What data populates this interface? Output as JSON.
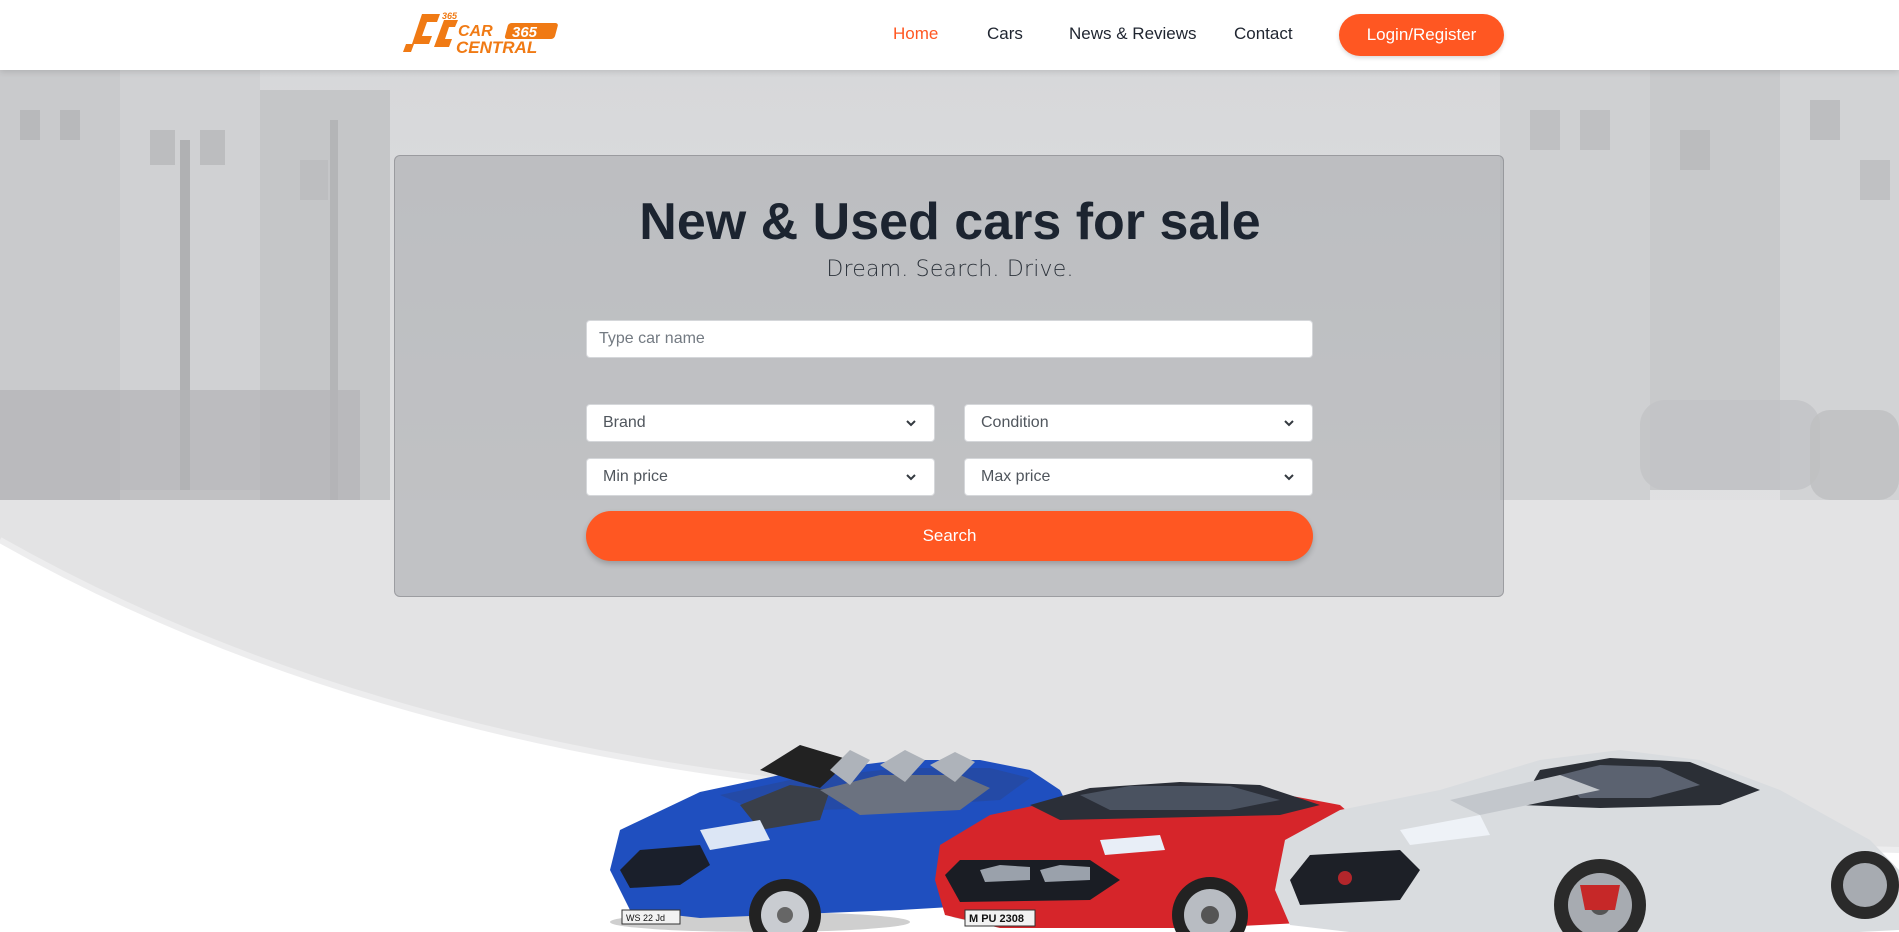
{
  "brand": {
    "logo_icon": "car-central-365-logo",
    "colors": {
      "accent": "#ff5722",
      "logo_orange": "#f07a14",
      "dark_text": "#1c2430"
    }
  },
  "nav": {
    "items": [
      {
        "label": "Home",
        "active": true
      },
      {
        "label": "Cars",
        "active": false
      },
      {
        "label": "News & Reviews",
        "active": false
      },
      {
        "label": "Contact",
        "active": false
      }
    ],
    "login_label": "Login/Register"
  },
  "hero": {
    "title": "New & Used cars for sale",
    "subtitle": "Dream. Search. Drive."
  },
  "search": {
    "car_name_placeholder": "Type car name",
    "brand_label": "Brand",
    "condition_label": "Condition",
    "min_price_label": "Min price",
    "max_price_label": "Max price",
    "search_label": "Search"
  },
  "cars": {
    "items": [
      {
        "name": "blue-convertible",
        "plate": "WS 22 Jd"
      },
      {
        "name": "red-sports-car",
        "plate": "M PU 2308"
      },
      {
        "name": "silver-coupe",
        "plate": ""
      }
    ]
  }
}
